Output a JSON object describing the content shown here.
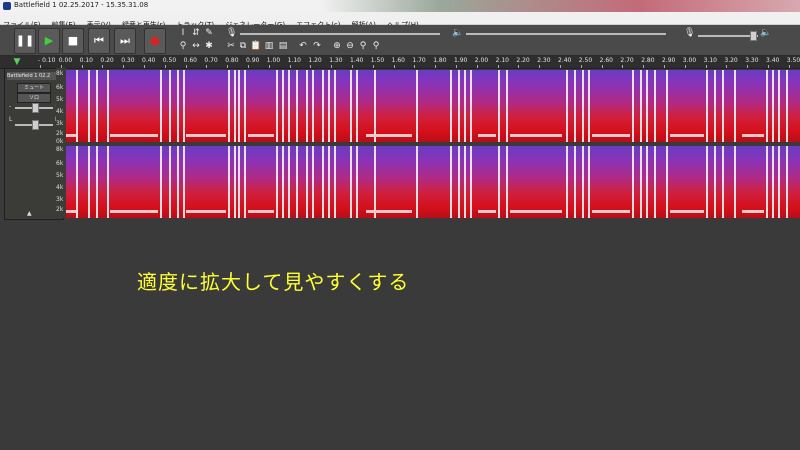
{
  "window": {
    "title": "Battlefield 1 02.25.2017 - 15.35.31.08"
  },
  "menu": [
    "ファイル(F)",
    "編集(E)",
    "表示(V)",
    "録音と再生(r)",
    "トラック(T)",
    "ジェネレーター(G)",
    "エフェクト(c)",
    "解析(A)",
    "ヘルプ(H)"
  ],
  "transport": {
    "pause": "❚❚",
    "play": "▶",
    "stop": "■",
    "skip_start": "⏮",
    "skip_end": "⏭",
    "record": "●"
  },
  "timeline": {
    "ticks": [
      "- 0.10",
      "0.00",
      "0.10",
      "0.20",
      "0.30",
      "0.40",
      "0.50",
      "0.60",
      "0.70",
      "0.80",
      "0.90",
      "1.00",
      "1.10",
      "1.20",
      "1.30",
      "1.40",
      "1.50",
      "1.60",
      "1.70",
      "1.80",
      "1.90",
      "2.00",
      "2.10",
      "2.20",
      "2.30",
      "2.40",
      "2.50",
      "2.60",
      "2.70",
      "2.80",
      "2.90",
      "3.00",
      "3.10",
      "3.20",
      "3.30",
      "3.40",
      "3.50"
    ]
  },
  "track": {
    "name": "Battlefield 1 02.2",
    "mute": "ミュート",
    "solo": "ソロ",
    "gain_minus": "-",
    "gain_plus": "+",
    "pan_left": "L",
    "pan_right": "R"
  },
  "scale": [
    "8k",
    "6k",
    "5k",
    "4k",
    "3k",
    "2k",
    "0k"
  ],
  "colors": {
    "accent_red": "#d4101a",
    "spectrum_top": "#6a3cc2",
    "caption": "#ffff33"
  },
  "caption": "適度に拡大して見やすくする"
}
